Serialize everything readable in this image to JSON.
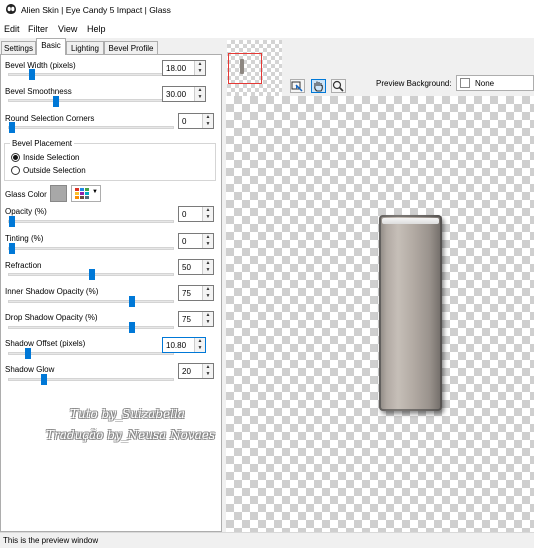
{
  "window": {
    "title": "Alien Skin | Eye Candy 5 Impact | Glass"
  },
  "menu": [
    "Edit",
    "Filter",
    "View",
    "Help"
  ],
  "tabs": [
    {
      "label": "Settings",
      "active": false
    },
    {
      "label": "Basic",
      "active": true
    },
    {
      "label": "Lighting",
      "active": false
    },
    {
      "label": "Bevel Profile",
      "active": false
    }
  ],
  "controls": {
    "bevel_width": {
      "label": "Bevel Width (pixels)",
      "value": "18.00"
    },
    "bevel_smoothness": {
      "label": "Bevel Smoothness",
      "value": "30.00"
    },
    "round_corners": {
      "label": "Round Selection Corners",
      "value": "0"
    },
    "bevel_placement": {
      "label": "Bevel Placement",
      "inside": "Inside Selection",
      "outside": "Outside Selection",
      "selected": "Inside Selection"
    },
    "glass_color": {
      "label": "Glass Color",
      "swatch": "#a8a8a8"
    },
    "opacity": {
      "label": "Opacity (%)",
      "value": "0"
    },
    "tinting": {
      "label": "Tinting (%)",
      "value": "0"
    },
    "refraction": {
      "label": "Refraction",
      "value": "50"
    },
    "inner_shadow_opacity": {
      "label": "Inner Shadow Opacity (%)",
      "value": "75"
    },
    "drop_shadow_opacity": {
      "label": "Drop Shadow Opacity (%)",
      "value": "75"
    },
    "shadow_offset": {
      "label": "Shadow Offset (pixels)",
      "value": "10.80"
    },
    "shadow_glow": {
      "label": "Shadow Glow",
      "value": "20"
    }
  },
  "preview": {
    "background_label": "Preview Background:",
    "background_value": "None",
    "tools": [
      "navigate-icon",
      "hand-icon",
      "zoom-icon"
    ]
  },
  "watermark": {
    "line1": "Tuto by_Suizabella",
    "line2": "Tradução by_Neusa Novaes"
  },
  "status": "This is the preview window"
}
